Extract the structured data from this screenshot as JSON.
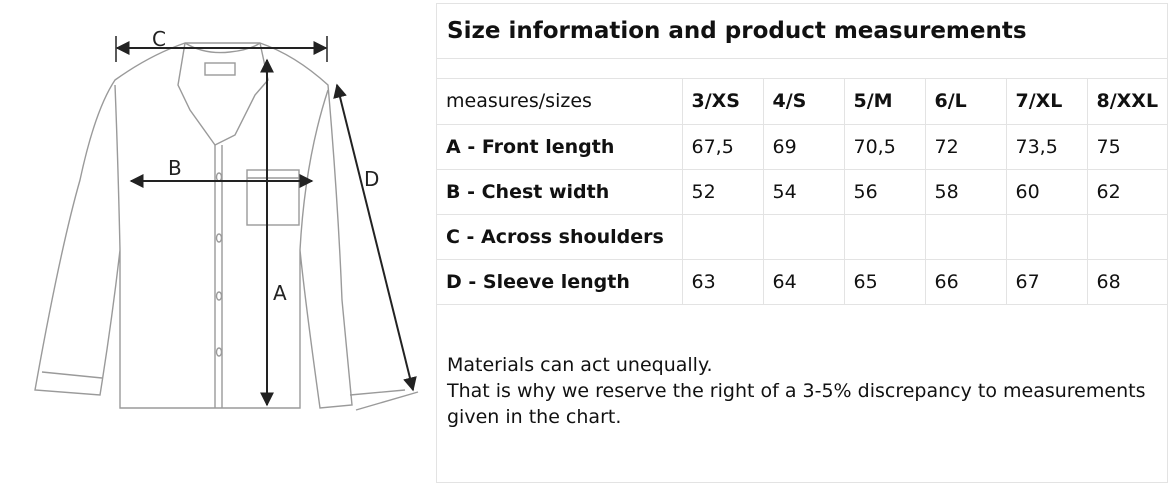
{
  "diagram": {
    "labels": {
      "a": "A",
      "b": "B",
      "c": "C",
      "d": "D"
    }
  },
  "panel": {
    "title": "Size information and product measurements",
    "table": {
      "header_label": "measures/sizes",
      "sizes": [
        "3/XS",
        "4/S",
        "5/M",
        "6/L",
        "7/XL",
        "8/XXL"
      ],
      "rows": [
        {
          "label": "A - Front length",
          "values": [
            "67,5",
            "69",
            "70,5",
            "72",
            "73,5",
            "75"
          ]
        },
        {
          "label": "B - Chest width",
          "values": [
            "52",
            "54",
            "56",
            "58",
            "60",
            "62"
          ]
        },
        {
          "label": "C - Across shoulders",
          "values": [
            "",
            "",
            "",
            "",
            "",
            ""
          ]
        },
        {
          "label": "D - Sleeve length",
          "values": [
            "63",
            "64",
            "65",
            "66",
            "67",
            "68"
          ]
        }
      ]
    },
    "note": {
      "line1": "Materials can act unequally.",
      "line2": "That is why we reserve the right of a 3-5% discrepancy to measurements given in the chart."
    }
  }
}
